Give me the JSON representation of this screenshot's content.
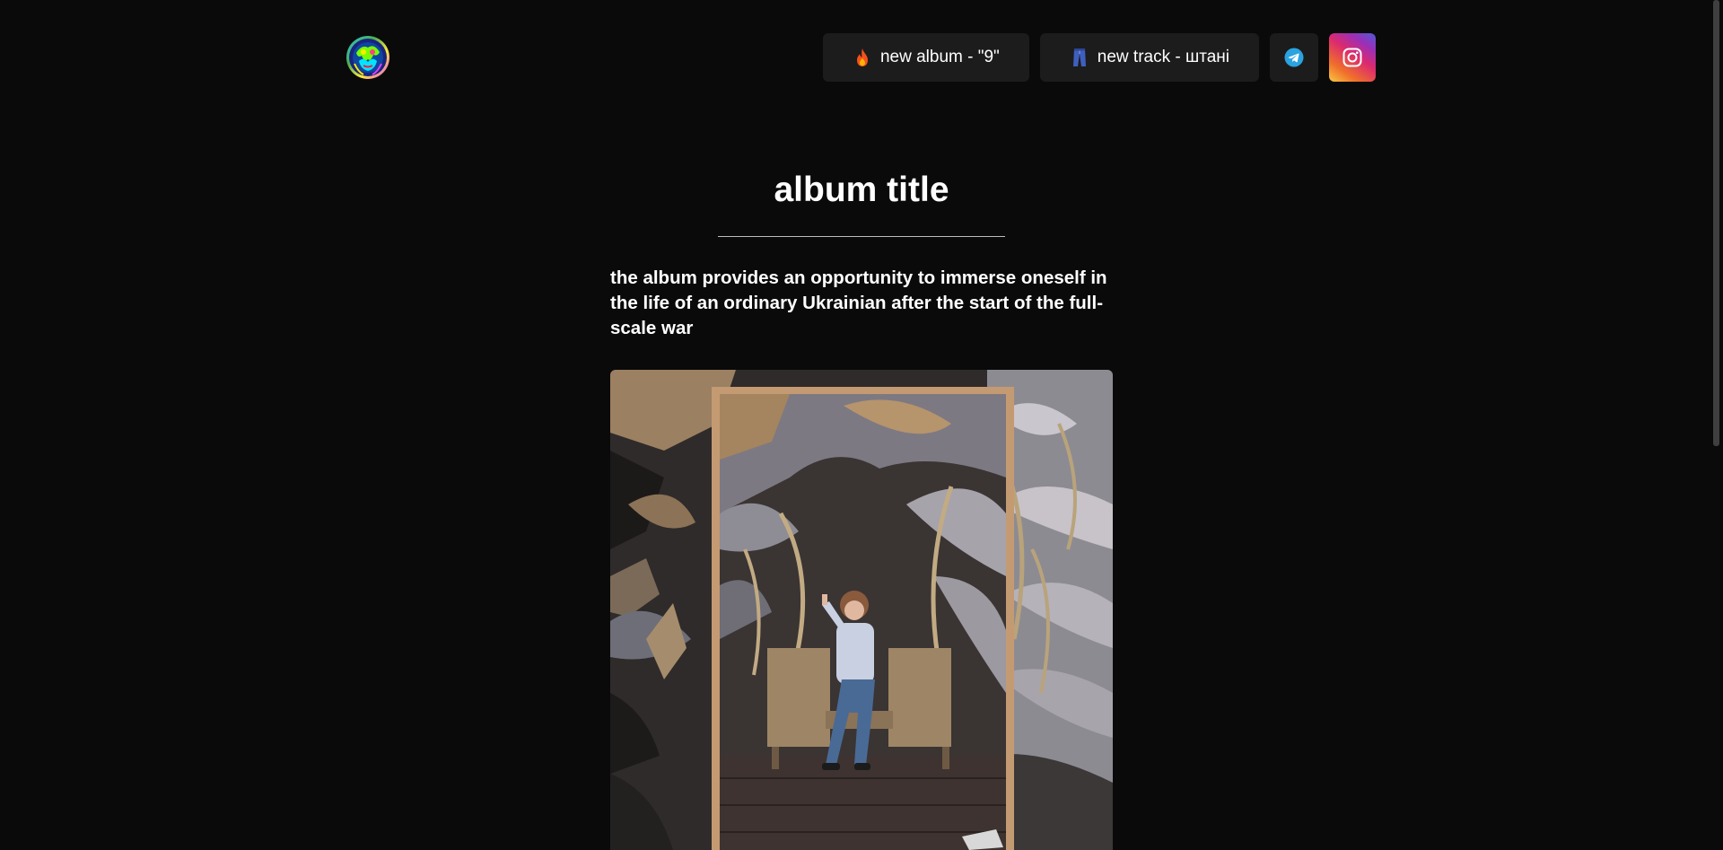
{
  "header": {
    "logo_icon": "colorful-round-logo-icon",
    "nav": [
      {
        "icon": "fire-emoji-icon",
        "label": "new album - \"9\""
      },
      {
        "icon": "jeans-emoji-icon",
        "label": "new track - штані"
      }
    ],
    "social": [
      {
        "icon": "telegram-icon",
        "color": "#2aa3e0"
      },
      {
        "icon": "instagram-icon",
        "color": "#dc2a6e"
      }
    ]
  },
  "main": {
    "title": "album title",
    "description": "the album provides an opportunity to immerse oneself in the life of an ordinary Ukrainian after the start of the full-scale war",
    "album_art_icon": "album-cover-photo"
  },
  "colors": {
    "background": "#0a0a0a",
    "button_bg": "#1c1c1c",
    "text": "#ffffff"
  }
}
